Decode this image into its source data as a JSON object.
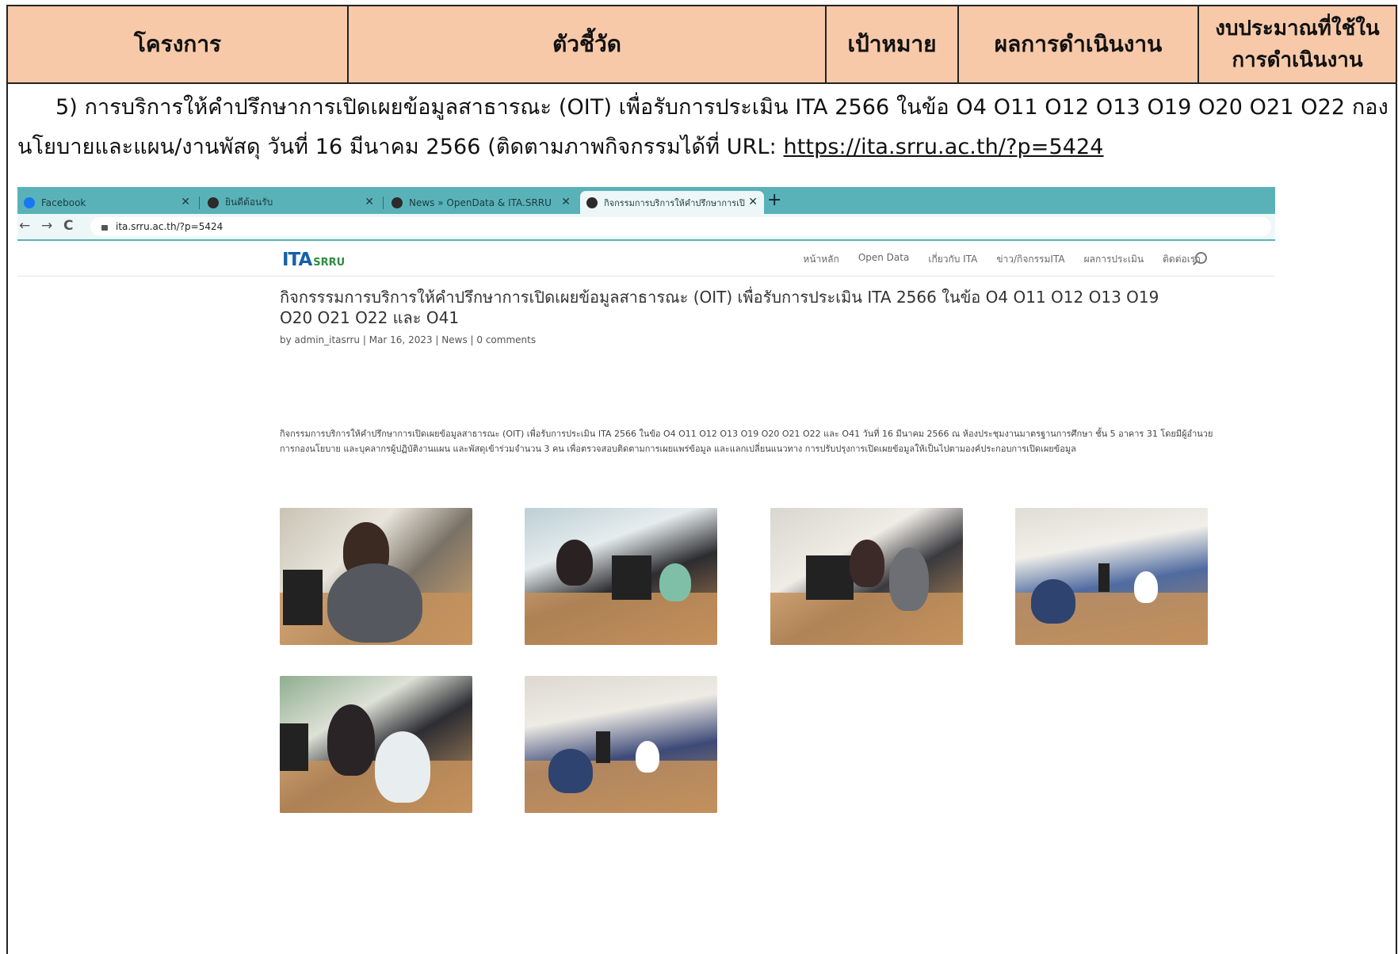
{
  "table_header": {
    "col1": "โครงการ",
    "col2": "ตัวชี้วัด",
    "col3": "เป้าหมาย",
    "col4": "ผลการดำเนินงาน",
    "col5": "งบประมาณที่ใช้ในการดำเนินงาน"
  },
  "paragraph": {
    "text": "5) การบริการให้คำปรึกษาการเปิดเผยข้อมูลสาธารณะ (OIT) เพื่อรับการประเมิน ITA 2566 ในข้อ O4 O11 O12 O13 O19 O20 O21 O22 กองนโยบายและแผน/งานพัสดุ วันที่ 16 มีนาคม 2566 (ติดตามภาพกิจกรรมได้ที่ URL: ",
    "link": "https://ita.srru.ac.th/?p=5424",
    "close": ""
  },
  "browser": {
    "tabs": [
      {
        "label": "Facebook",
        "icon": "facebook-icon"
      },
      {
        "label": "ยินดีต้อนรับ",
        "icon": "globe-icon"
      },
      {
        "label": "News » OpenData & ITA.SRRU",
        "icon": "globe-icon"
      },
      {
        "label": "กิจกรรมการบริการให้คำปรึกษาการเปิ",
        "icon": "globe-icon"
      }
    ],
    "new_tab": "+",
    "close_glyph": "✕",
    "url": "ita.srru.ac.th/?p=5424",
    "nav_back": "←",
    "nav_forward": "→",
    "nav_reload": "C"
  },
  "site": {
    "logo_main": "ITA",
    "logo_sub": "SRRU",
    "menu": [
      "หน้าหลัก",
      "Open Data",
      "เกี่ยวกับ ITA",
      "ข่าว/กิจกรรมITA",
      "ผลการประเมิน",
      "ติดต่อเรา"
    ],
    "post_title": "กิจกรรรมการบริการให้คำปรึกษาการเปิดเผยข้อมูลสาธารณะ (OIT) เพื่อรับการประเมิน ITA 2566 ในข้อ O4 O11 O12 O13 O19 O20 O21 O22 และ O41",
    "post_meta": "by admin_itasrru | Mar 16, 2023 | News | 0 comments",
    "post_body": "กิจกรรมการบริการให้คำปรึกษาการเปิดเผยข้อมูลสาธารณะ (OIT) เพื่อรับการประเมิน ITA 2566 ในข้อ O4 O11 O12 O13 O19 O20 O21 O22 และ O41 วันที่ 16 มีนาคม 2566 ณ ห้องประชุมงานมาตรฐานการศึกษา ชั้น 5 อาคาร 31 โดยมีผู้อำนวยการกองนโยบาย และบุคลากรผู้ปฏิบัติงานแผน และพัสดุเข้าร่วมจำนวน 3 คน เพื่อตรวจสอบติดตามการเผยแพร่ข้อมูล และแลกเปลี่ยนแนวทาง การปรับปรุงการเปิดเผยข้อมูลให้เป็นไปตามองค์ประกอบการเปิดเผยข้อมูล"
  }
}
